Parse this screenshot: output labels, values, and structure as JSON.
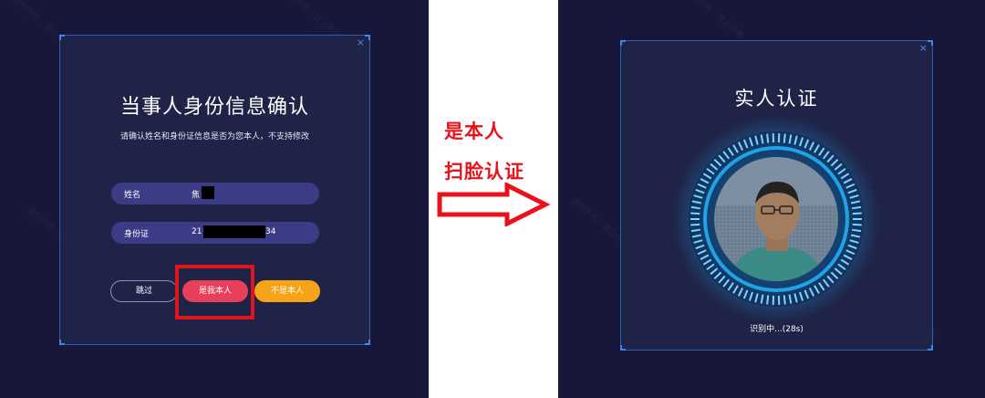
{
  "left_dialog": {
    "title": "当事人身份信息确认",
    "subtitle": "请确认姓名和身份证信息是否为您本人，不支持修改",
    "name_label": "姓名",
    "name_value": "焦",
    "id_label": "身份证",
    "id_value_start": "21",
    "id_value_end": "34",
    "skip_button": "跳过",
    "confirm_button": "是我本人",
    "not_me_button": "不是本人",
    "close_icon": "close-icon"
  },
  "annotation": {
    "line1": "是本人",
    "line2": "扫脸认证",
    "arrow_icon": "right-arrow-icon",
    "color": "#e8121a"
  },
  "right_dialog": {
    "title": "实人认证",
    "status": "识别中...(28s)",
    "close_icon": "close-icon"
  },
  "colors": {
    "background": "#17163b",
    "card": "#1f2347",
    "confirm": "#e8405a",
    "not_me": "#f7a318",
    "info_row": "#3c3b85",
    "scan_ring": "#1fa3e6"
  }
}
